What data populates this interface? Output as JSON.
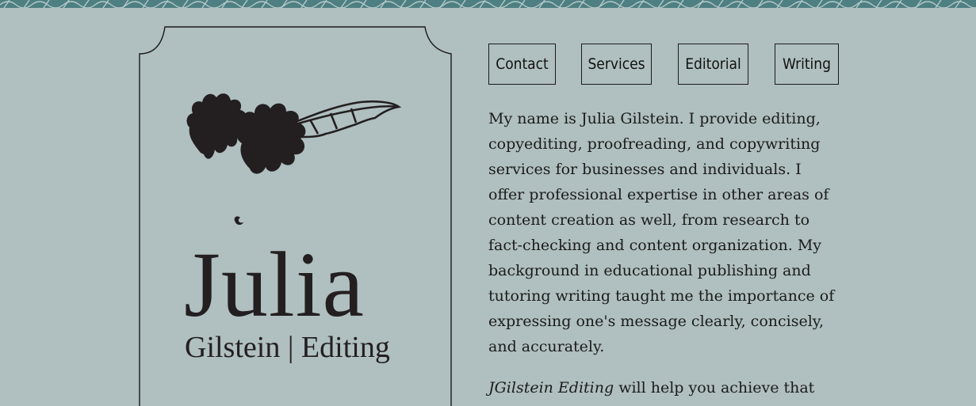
{
  "logo": {
    "name": "Julia",
    "tagline": "Gilstein | Editing",
    "leaf_icon": "oak-leaf-icon"
  },
  "nav": {
    "items": [
      {
        "label": "Contact"
      },
      {
        "label": "Services"
      },
      {
        "label": "Editorial"
      },
      {
        "label": "Writing"
      }
    ]
  },
  "content": {
    "intro": "My name is Julia Gilstein. I provide editing, copyediting, proofreading, and copywriting services for businesses and individuals. I offer professional expertise in other areas of content creation as well, from research to fact-checking and content organization. My background in educational publishing and tutoring writing taught me the importance of expressing one's message clearly, concisely, and accurately.",
    "second_brand": "JGilstein Editing",
    "second_rest": " will help you achieve that"
  },
  "colors": {
    "background": "#b0bfbf",
    "band": "#4e7f82",
    "text": "#1b1b1b"
  }
}
